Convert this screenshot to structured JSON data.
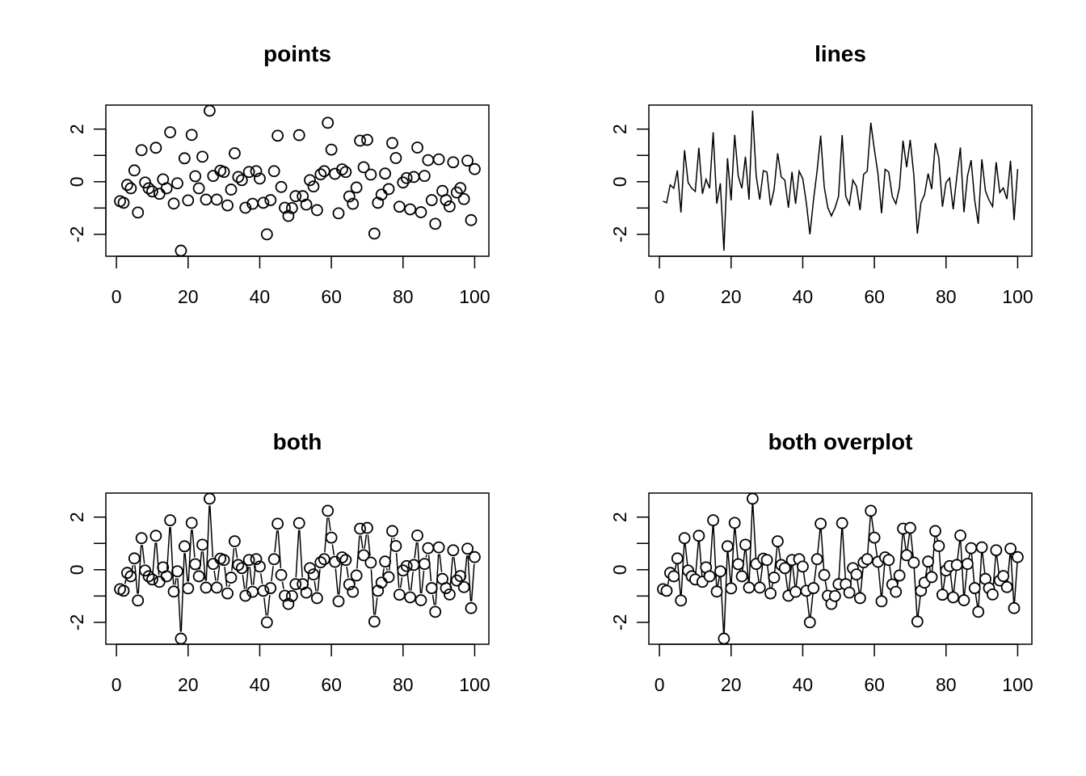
{
  "chart_data": [
    {
      "type": "scatter",
      "title": "points",
      "plot_type": "p"
    },
    {
      "type": "line",
      "title": "lines",
      "plot_type": "l"
    },
    {
      "type": "line",
      "title": "both",
      "plot_type": "b"
    },
    {
      "type": "line",
      "title": "both overplot",
      "plot_type": "o"
    }
  ],
  "shared": {
    "x": "1..100 (index)",
    "xlim": [
      1,
      100
    ],
    "ylim": [
      -2.62,
      2.7
    ],
    "x_ticks": [
      0,
      20,
      40,
      60,
      80,
      100
    ],
    "y_ticks": [
      -2,
      -1,
      0,
      1,
      2
    ],
    "y_tick_labels": [
      "-2",
      "0",
      "2"
    ],
    "y_tick_label_values": [
      -2,
      0,
      2
    ],
    "grid": false,
    "color": "#000000",
    "values": [
      -0.74,
      -0.8,
      -0.12,
      -0.25,
      0.43,
      -1.17,
      1.2,
      -0.03,
      -0.25,
      -0.37,
      1.29,
      -0.46,
      0.09,
      -0.25,
      1.88,
      -0.83,
      -0.06,
      -2.62,
      0.89,
      -0.71,
      1.78,
      0.21,
      -0.25,
      0.95,
      -0.68,
      2.7,
      0.22,
      -0.68,
      0.42,
      0.37,
      -0.9,
      -0.3,
      1.08,
      0.18,
      0.06,
      -0.99,
      0.37,
      -0.84,
      0.4,
      0.12,
      -0.8,
      -2.0,
      -0.7,
      0.4,
      1.75,
      -0.2,
      -0.99,
      -1.3,
      -1.0,
      -0.55,
      1.77,
      -0.55,
      -0.87,
      0.06,
      -0.18,
      -1.08,
      0.28,
      0.4,
      2.24,
      1.22,
      0.3,
      -1.2,
      0.47,
      0.37,
      -0.56,
      -0.84,
      -0.22,
      1.56,
      0.55,
      1.59,
      0.27,
      -1.97,
      -0.8,
      -0.49,
      0.31,
      -0.28,
      1.47,
      0.9,
      -0.95,
      -0.03,
      0.14,
      -1.05,
      0.18,
      1.3,
      -1.16,
      0.22,
      0.82,
      -0.7,
      -1.6,
      0.85,
      -0.35,
      -0.7,
      -0.94,
      0.74,
      -0.41,
      -0.24,
      -0.66,
      0.8,
      -1.46,
      0.48
    ]
  }
}
